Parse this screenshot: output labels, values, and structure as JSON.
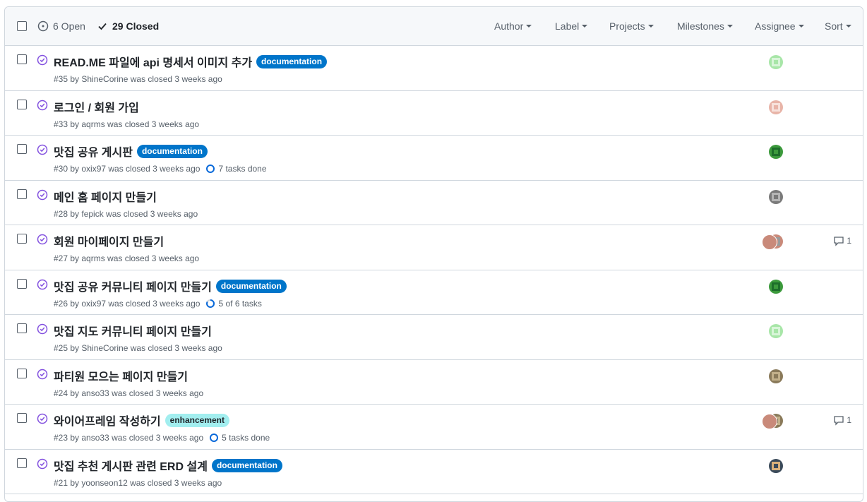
{
  "header": {
    "open_label": "6 Open",
    "closed_label": "29 Closed",
    "filters": [
      "Author",
      "Label",
      "Projects",
      "Milestones",
      "Assignee",
      "Sort"
    ]
  },
  "issues": [
    {
      "title": "READ.ME 파일에 api 명세서 이미지 추가",
      "label": "documentation",
      "meta": "#35 by ShineCorine was closed 3 weeks ago",
      "tasks": "",
      "comments": ""
    },
    {
      "title": "로그인 / 회원 가입",
      "label": "",
      "meta": "#33 by aqrms was closed 3 weeks ago",
      "tasks": "",
      "comments": ""
    },
    {
      "title": "맛집 공유 게시판",
      "label": "documentation",
      "meta": "#30 by oxix97 was closed 3 weeks ago",
      "tasks": "7 tasks done",
      "comments": ""
    },
    {
      "title": "메인 홈 페이지 만들기",
      "label": "",
      "meta": "#28 by fepick was closed 3 weeks ago",
      "tasks": "",
      "comments": ""
    },
    {
      "title": "회원 마이페이지 만들기",
      "label": "",
      "meta": "#27 by aqrms was closed 3 weeks ago",
      "tasks": "",
      "comments": "1"
    },
    {
      "title": "맛집 공유 커뮤니티 페이지 만들기",
      "label": "documentation",
      "meta": "#26 by oxix97 was closed 3 weeks ago",
      "tasks": "5 of 6 tasks",
      "comments": ""
    },
    {
      "title": "맛집 지도 커뮤니티 페이지 만들기",
      "label": "",
      "meta": "#25 by ShineCorine was closed 3 weeks ago",
      "tasks": "",
      "comments": ""
    },
    {
      "title": "파티원 모으는 페이지 만들기",
      "label": "",
      "meta": "#24 by anso33 was closed 3 weeks ago",
      "tasks": "",
      "comments": ""
    },
    {
      "title": "와이어프레임 작성하기",
      "label": "enhancement",
      "meta": "#23 by anso33 was closed 3 weeks ago",
      "tasks": "5 tasks done",
      "comments": "1"
    },
    {
      "title": "맛집 추천 게시판 관련 ERD 설계",
      "label": "documentation",
      "meta": "#21 by yoonseon12 was closed 3 weeks ago",
      "tasks": "",
      "comments": ""
    }
  ],
  "colors": {
    "closed_purple": "#8250df",
    "doc_label": "#0075ca",
    "enh_label": "#a2eeef",
    "progress_blue": "#0969da"
  }
}
